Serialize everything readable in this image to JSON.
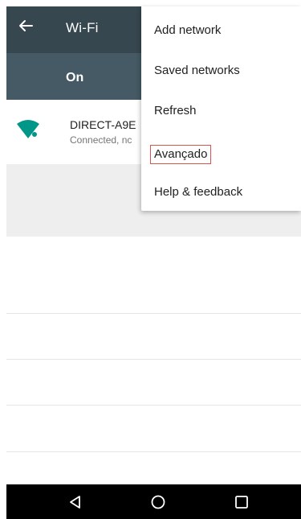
{
  "toolbar": {
    "title": "Wi-Fi",
    "back_icon": "arrow-back-icon"
  },
  "switch_bar": {
    "label": "On"
  },
  "network": {
    "name": "DIRECT-A9E",
    "status": "Connected, nc",
    "icon": "wifi-locked-icon"
  },
  "menu": {
    "items": [
      {
        "label": "Add network"
      },
      {
        "label": "Saved networks"
      },
      {
        "label": "Refresh"
      },
      {
        "label": "Avançado"
      },
      {
        "label": "Help & feedback"
      }
    ]
  },
  "nav_bar": {
    "back_icon": "triangle-back-icon",
    "home_icon": "circle-home-icon",
    "recents_icon": "square-recents-icon"
  },
  "colors": {
    "toolbar": "#37474f",
    "switch_bar": "#455a64",
    "wifi_icon": "#009688",
    "highlight_border": "#d9534f"
  }
}
